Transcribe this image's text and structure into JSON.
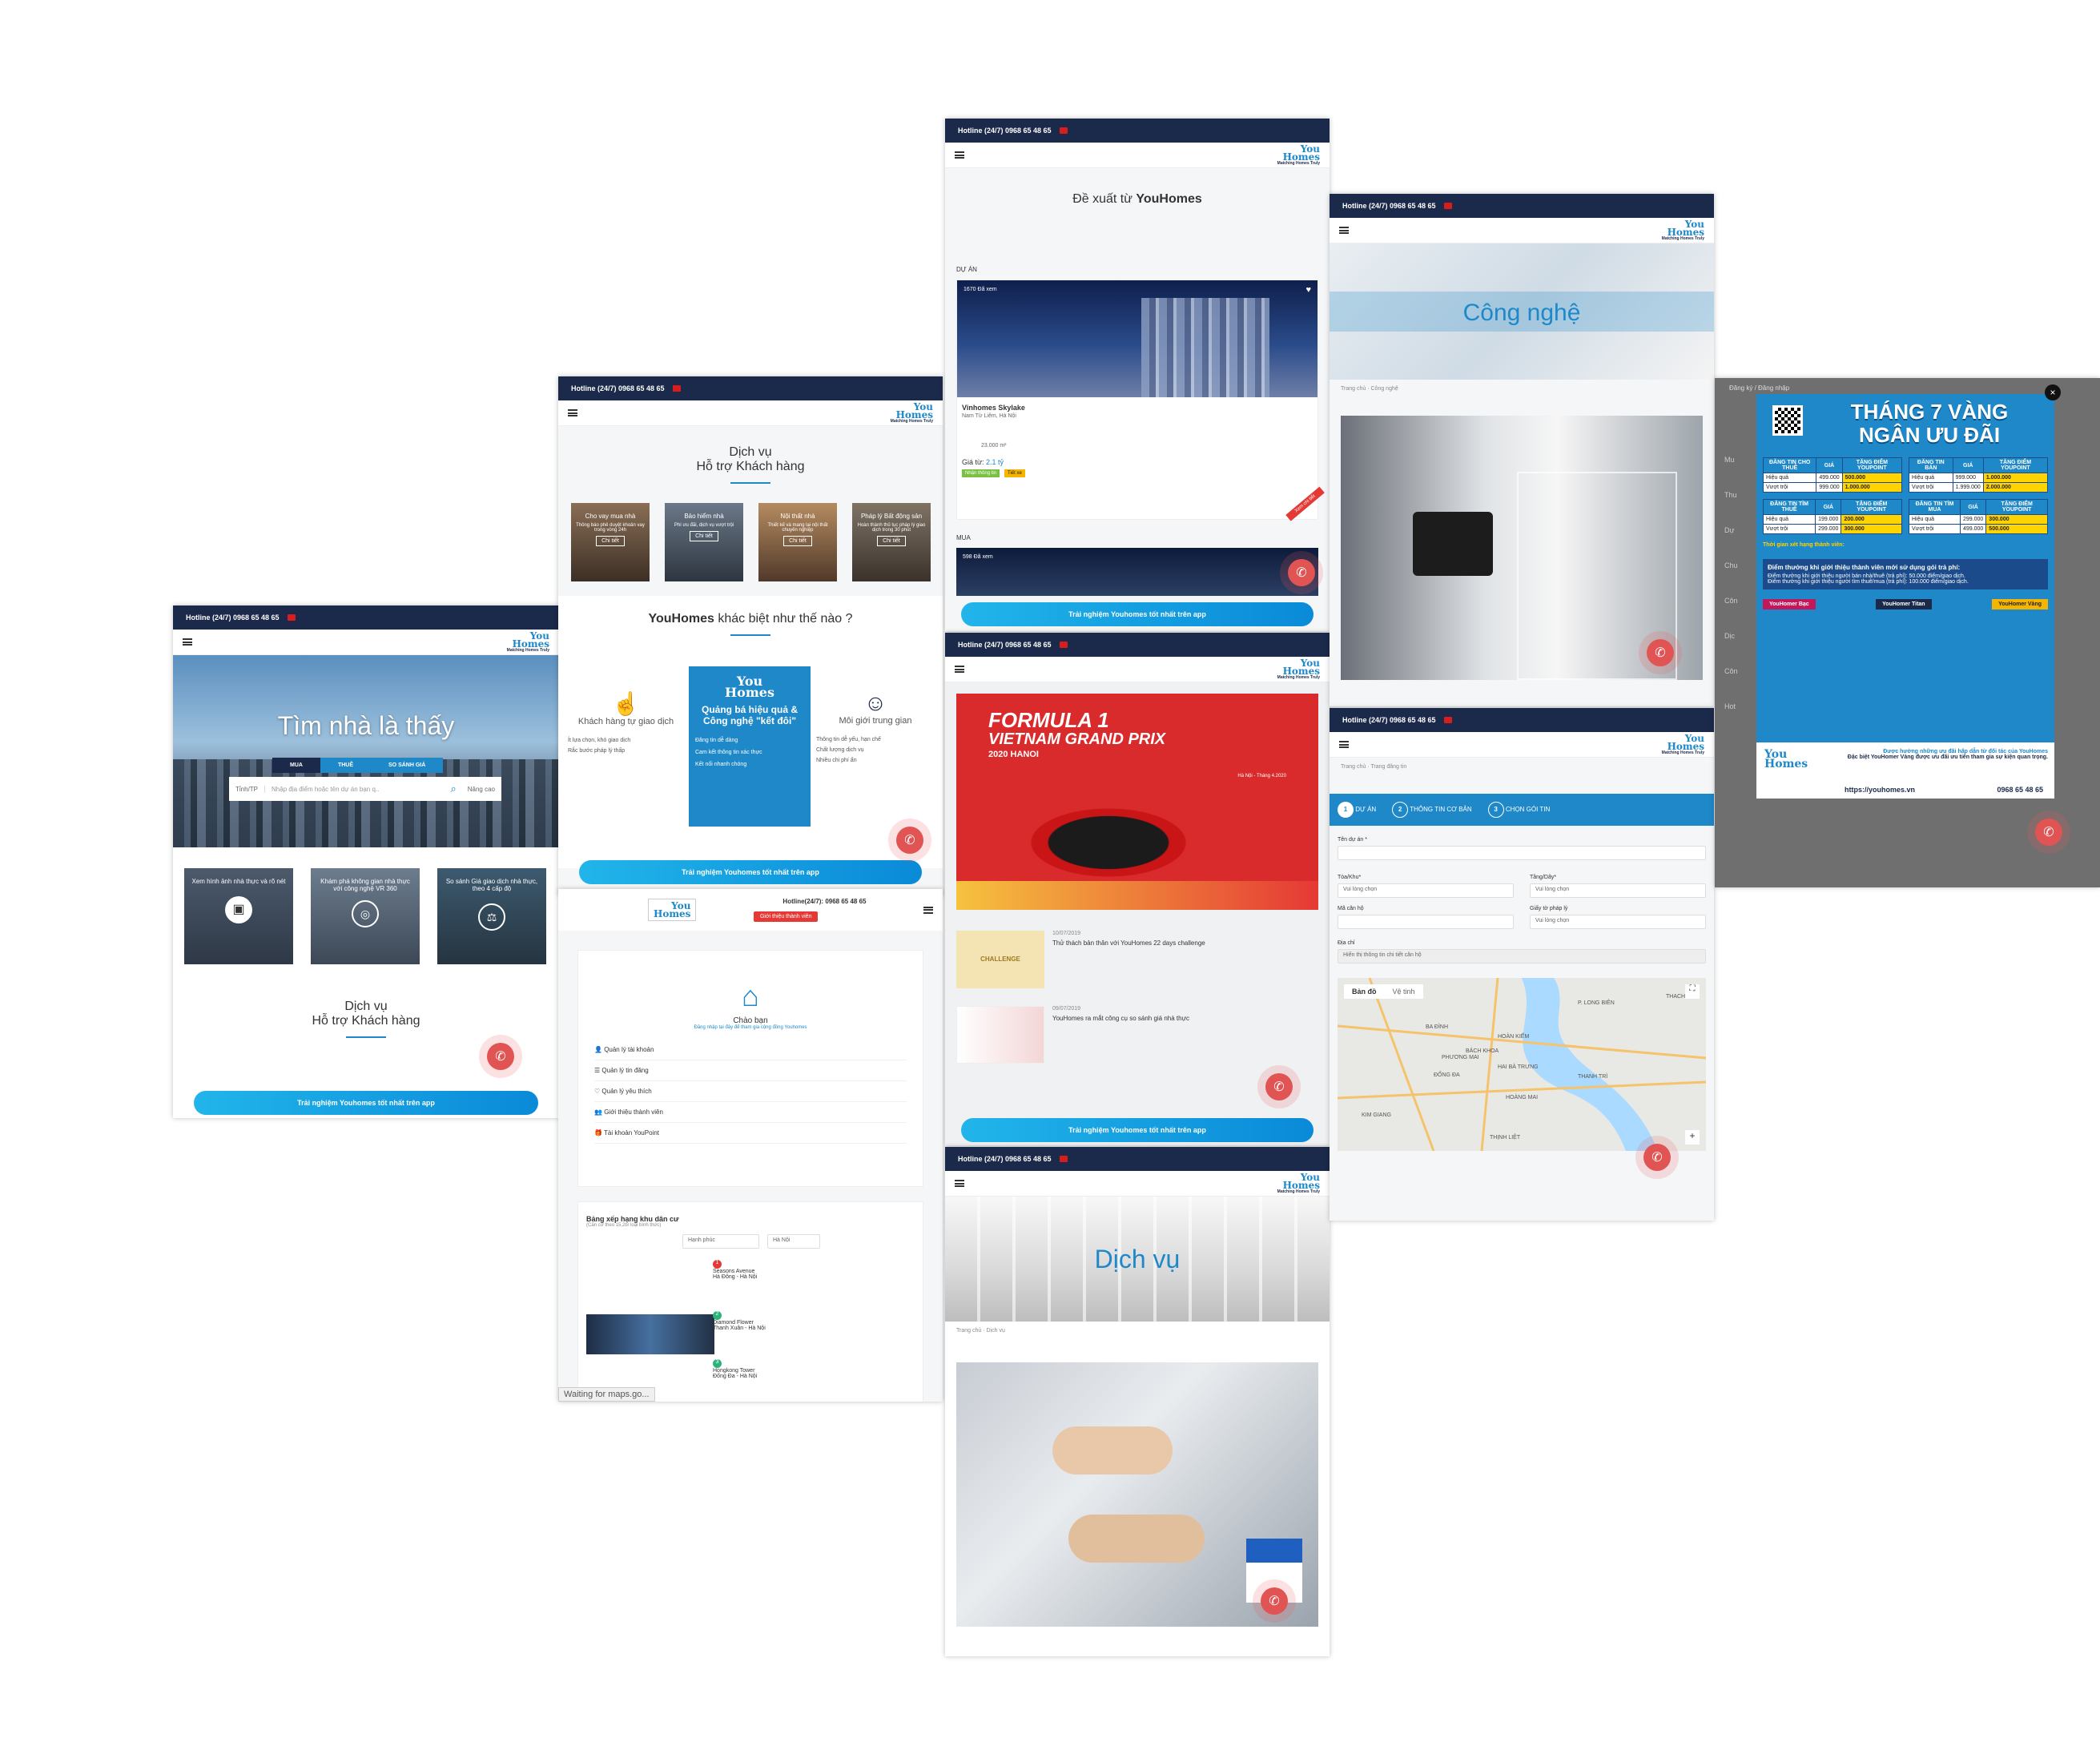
{
  "common": {
    "hotline": "Hotline (24/7) 0968 65 48 65",
    "hotline_alt": "Hotline(24/7): 0968 65 48 65",
    "logo_line1": "You",
    "logo_line2": "Homes",
    "logo_tag": "Matching Homes Truly",
    "app_bar": "Trải nghiệm Youhomes tốt nhất trên app"
  },
  "home": {
    "hero": "Tìm nhà là thấy",
    "tabs": [
      "MUA",
      "THUÊ",
      "SO SÁNH GIÁ"
    ],
    "province": "Tỉnh/TP",
    "search_placeholder": "Nhập địa điểm hoặc tên dự án bạn q..",
    "advanced": "Nâng cao",
    "features": [
      "Xem hình ảnh nhà thực và rõ nét",
      "Khám phá không gian nhà thực với công nghệ VR 360",
      "So sánh Giá giao dịch nhà thực, theo 4 cấp độ"
    ],
    "service_title_1": "Dịch vụ",
    "service_title_2": "Hỗ trợ Khách hàng"
  },
  "services": {
    "title_1": "Dịch vụ",
    "title_2": "Hỗ trợ Khách hàng",
    "cards": [
      {
        "title": "Cho vay mua nhà",
        "desc": "Thông báo phê duyệt khoản vay trong vòng 24h"
      },
      {
        "title": "Bảo hiểm nhà",
        "desc": "Phí ưu đãi, dịch vụ vượt trội"
      },
      {
        "title": "Nội thất nhà",
        "desc": "Thiết kế và mang lại nội thất chuyên nghiệp"
      },
      {
        "title": "Pháp lý Bất động sản",
        "desc": "Hoàn thành thủ tục pháp lý giao dịch trong 30 phút"
      }
    ],
    "detail": "Chi tiết",
    "diff_prefix": "YouHomes",
    "diff_suffix": " khác biệt như thế nào ?",
    "cols": [
      {
        "title": "Khách hàng tự giao dịch",
        "items": [
          "Ít lựa chọn, khó giao dịch",
          "Rắc bước pháp lý thấp"
        ]
      },
      {
        "title": "Quảng bá hiệu quả & Công nghệ \"kết đôi\"",
        "items": [
          "Đăng tin dễ dàng",
          "Cam kết thông tin xác thực",
          "Kết nối nhanh chóng"
        ]
      },
      {
        "title": "Môi giới trung gian",
        "items": [
          "Thông tin dễ yếu, hạn chế",
          "Chất lượng dịch vụ",
          "Nhiều chi phí ẩn"
        ]
      }
    ]
  },
  "account": {
    "intro_btn": "Giới thiệu thành viên",
    "greet": "Chào bạn",
    "greet_sub": "Đăng nhập tại đây để tham gia cộng đồng Youhomes",
    "menu": [
      "Quản lý tài khoản",
      "Quản lý tin đăng",
      "Quản lý yêu thích",
      "Giới thiệu thành viên",
      "Tài khoản YouPoint"
    ],
    "rank_title": "Bảng xếp hạng khu dân cư",
    "rank_sub": "(Căn cứ theo 15,2b/ loại bình thức)",
    "filter1": "Hạnh phúc",
    "filter2": "Hà Nội",
    "ranks": [
      {
        "no": "1",
        "name": "Seasons Avenue",
        "loc": "Hà Đông - Hà Nội"
      },
      {
        "no": "2",
        "name": "Diamond Flower",
        "loc": "Thanh Xuân - Hà Nội"
      },
      {
        "no": "3",
        "name": "Hongkong Tower",
        "loc": "Đống Đa - Hà Nội"
      }
    ],
    "status": "Waiting for maps.go..."
  },
  "suggest": {
    "title_prefix": "Đề xuất từ ",
    "title_brand": "YouHomes",
    "section_project": "DỰ ÁN",
    "views1": "1670 Đã xem",
    "project_name": "Vinhomes Skylake",
    "project_loc": "Nam Từ Liêm, Hà Nội",
    "area": "23.000 m²",
    "price_label": "Giá từ: ",
    "price": "2.1 tỷ",
    "tag1": "Nhận thông tin",
    "tag2": "Tiết xe",
    "ribbon": "Xem chi tiết",
    "section_buy": "MUA",
    "views2": "598 Đã xem"
  },
  "news": {
    "banner_l1": "FORMULA 1",
    "banner_l2": "VIETNAM GRAND PRIX",
    "banner_l3": "2020 HANOI",
    "banner_date": "Hà Nội - Tháng 4.2020",
    "items": [
      {
        "date": "10/07/2019",
        "title": "Thử thách bản thân với YouHomes 22 days challenge",
        "thumb": "CHALLENGE"
      },
      {
        "date": "09/07/2019",
        "title": "YouHomes ra mắt công cụ so sánh giá nhà thực",
        "thumb": ""
      }
    ]
  },
  "service2": {
    "hero": "Dịch vụ",
    "crumb_home": "Trang chủ",
    "crumb_cur": "Dịch vụ"
  },
  "tech": {
    "hero": "Công nghệ",
    "crumb_home": "Trang chủ",
    "crumb_cur": "Công nghệ"
  },
  "post": {
    "crumb_home": "Trang chủ",
    "crumb_cur": "Trang đăng tin",
    "steps": [
      "DỰ ÁN",
      "THÔNG TIN CƠ BẢN",
      "CHỌN GÓI TIN"
    ],
    "f_project": "Tên dự án *",
    "f_tower": "Tòa/Khu*",
    "f_floor": "Tầng/Dãy*",
    "choose": "Vui lòng chọn",
    "f_unit": "Mã căn hộ",
    "f_legal": "Giấy tờ pháp lý",
    "f_addr": "Địa chỉ",
    "addr_ph": "Hiển thị thông tin chi tiết căn hộ",
    "map_tabs": [
      "Bản đồ",
      "Vệ tinh"
    ],
    "map_labels": [
      "P. LONG BIÊN",
      "HOÀN KIẾM",
      "BA ĐÌNH",
      "ĐỐNG ĐA",
      "HAI BÀ TRƯNG",
      "THANH TRÌ",
      "HOÀNG MAI",
      "KIM GIANG",
      "THỊNH LIỆT",
      "BÁCH KHOA",
      "PHƯƠNG MAI",
      "THACH E"
    ]
  },
  "promo": {
    "top_link": "Đăng ký / Đăng nhập",
    "title_1": "THÁNG 7 VÀNG",
    "title_2": "NGÂN ƯU ĐÃI",
    "tables": [
      {
        "head": [
          "ĐĂNG TIN CHO THUÊ",
          "GIÁ",
          "TẶNG ĐIỂM YOUPOINT"
        ],
        "rows": [
          [
            "Hiệu quả",
            "499.000",
            "500.000"
          ],
          [
            "Vượt trội",
            "999.000",
            "1.000.000"
          ]
        ]
      },
      {
        "head": [
          "ĐĂNG TIN BÁN",
          "GIÁ",
          "TẶNG ĐIỂM YOUPOINT"
        ],
        "rows": [
          [
            "Hiệu quả",
            "999.000",
            "1.000.000"
          ],
          [
            "Vượt trội",
            "1.999.000",
            "2.000.000"
          ]
        ]
      },
      {
        "head": [
          "ĐĂNG TIN TÌM THUÊ",
          "GIÁ",
          "TẶNG ĐIỂM YOUPOINT"
        ],
        "rows": [
          [
            "Hiệu quả",
            "199.000",
            "200.000"
          ],
          [
            "Vượt trội",
            "299.000",
            "300.000"
          ]
        ]
      },
      {
        "head": [
          "ĐĂNG TIN TÌM MUA",
          "GIÁ",
          "TẶNG ĐIỂM YOUPOINT"
        ],
        "rows": [
          [
            "Hiệu quả",
            "299.000",
            "300.000"
          ],
          [
            "Vượt trội",
            "499.000",
            "500.000"
          ]
        ]
      }
    ],
    "rank_time": "Thời gian xét hạng thành viên:",
    "bonus_title": "Điểm thưởng khi giới thiệu thành viên mới sử dụng gói trả phí:",
    "bonus_1": "Điểm thưởng khi giới thiệu người bán nhà/thuê (trả phí): 50.000 điểm/giao dịch.",
    "bonus_2": "Điểm thưởng khi giới thiệu người tìm thuê/mua (trả phí): 100.000 điểm/giao dịch.",
    "tiers": [
      "YouHomer Bạc",
      "YouHomer Titan",
      "YouHomer Vàng"
    ],
    "footer_note": "Được hưởng những ưu đãi hấp dẫn từ đối tác của YouHomes",
    "footer_note2": "Đặc biệt YouHomer Vàng được ưu đãi ưu tiên tham gia sự kiện quan trọng.",
    "url": "https://youhomes.vn",
    "phone": "0968 65 48 65",
    "side_items": [
      "Mu",
      "Thu",
      "Dự",
      "Chu",
      "Côn",
      "Dịc",
      "Côn",
      "Hot"
    ]
  },
  "colors": {
    "navy": "#1b2a4a",
    "blue": "#1e88c9",
    "red": "#e05454",
    "yellow": "#ffd400"
  }
}
